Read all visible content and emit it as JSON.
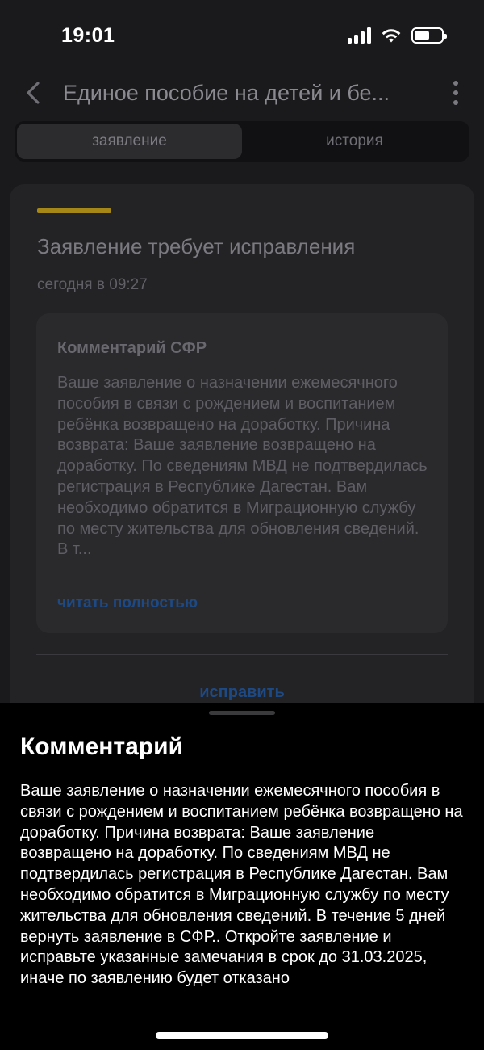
{
  "status_bar": {
    "time": "19:01"
  },
  "nav": {
    "title": "Единое пособие на детей и бе..."
  },
  "tabs": [
    {
      "label": "заявление",
      "active": true
    },
    {
      "label": "история",
      "active": false
    }
  ],
  "card": {
    "accent_color": "#a48716",
    "title": "Заявление требует исправления",
    "date": "сегодня в 09:27",
    "comment_heading": "Комментарий СФР",
    "comment_preview": "Ваше заявление о назначении ежемесячного пособия в связи с рождением и воспитанием ребёнка возвращено на доработку. Причина возврата: Ваше заявление возвращено на доработку. По сведениям МВД не подтвердилась регистрация в Республике Дагестан. Вам необходимо обратится в Миграционную службу по месту жительства для обновления сведений. В т...",
    "read_more": "читать полностью",
    "fix_action": "исправить"
  },
  "sheet": {
    "title": "Комментарий",
    "text": "Ваше заявление о назначении ежемесячного пособия в связи с рождением и воспитанием ребёнка возвращено на доработку. Причина возврата: Ваше заявление возвращено на доработку. По сведениям МВД не подтвердилась регистрация в Республике Дагестан. Вам необходимо обратится в Миграционную службу по месту жительства для обновления сведений. В течение 5 дней вернуть заявление в СФР.. Откройте заявление и исправьте указанные замечания в срок до 31.03.2025, иначе по заявлению будет отказано"
  }
}
